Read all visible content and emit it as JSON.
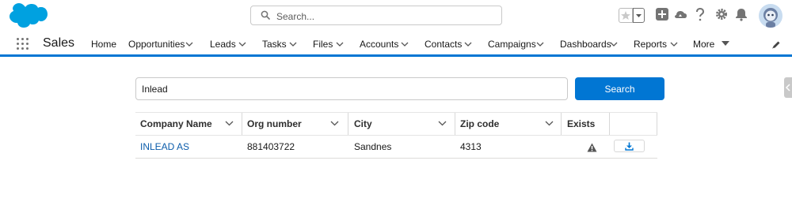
{
  "header": {
    "search_placeholder": "Search..."
  },
  "nav": {
    "app_name": "Sales",
    "items": [
      {
        "label": "Home",
        "has_menu": false
      },
      {
        "label": "Opportunities",
        "has_menu": true
      },
      {
        "label": "Leads",
        "has_menu": true
      },
      {
        "label": "Tasks",
        "has_menu": true
      },
      {
        "label": "Files",
        "has_menu": true
      },
      {
        "label": "Accounts",
        "has_menu": true
      },
      {
        "label": "Contacts",
        "has_menu": true
      },
      {
        "label": "Campaigns",
        "has_menu": true
      },
      {
        "label": "Dashboards",
        "has_menu": true
      },
      {
        "label": "Reports",
        "has_menu": true
      },
      {
        "label": "More",
        "has_menu": true
      }
    ]
  },
  "lookup": {
    "query": "Inlead",
    "button_label": "Search"
  },
  "table": {
    "columns": [
      "Company Name",
      "Org number",
      "City",
      "Zip code",
      "Exists"
    ],
    "rows": [
      {
        "company": "INLEAD AS",
        "org_number": "881403722",
        "city": "Sandnes",
        "zip": "4313",
        "exists_icon": "warning-icon",
        "action_icon": "download-icon"
      }
    ]
  },
  "icons": [
    "salesforce-cloud-logo",
    "search-icon",
    "favorite-star-icon",
    "add-icon",
    "trailhead-icon",
    "help-icon",
    "setup-gear-icon",
    "notifications-bell-icon",
    "avatar",
    "app-launcher-icon",
    "edit-nav-icon",
    "warning-icon",
    "download-icon"
  ],
  "colors": {
    "brand": "#0176d3",
    "link": "#0b5cab",
    "logo": "#00a1e0"
  }
}
